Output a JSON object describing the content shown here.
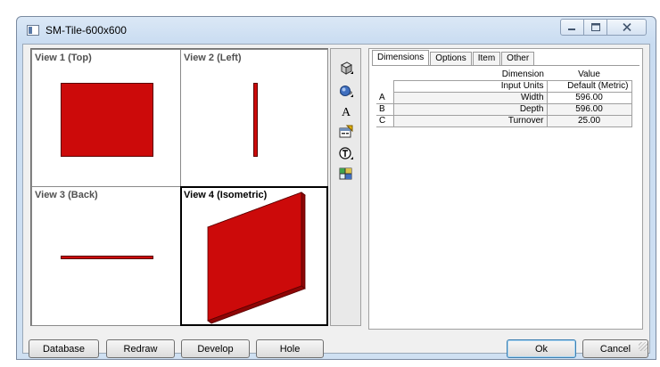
{
  "window": {
    "title": "SM-Tile-600x600"
  },
  "views": [
    {
      "label": "View 1 (Top)"
    },
    {
      "label": "View 2 (Left)"
    },
    {
      "label": "View 3 (Back)"
    },
    {
      "label": "View 4 (Isometric)"
    }
  ],
  "tools": [
    "cube-view-icon",
    "sphere-render-icon",
    "text-A-icon",
    "properties-icon",
    "dimension-T-icon",
    "grid-map-icon"
  ],
  "tabs": [
    "Dimensions",
    "Options",
    "Item",
    "Other"
  ],
  "grid": {
    "header": {
      "dimension": "Dimension",
      "value": "Value"
    },
    "subheader": {
      "dimension": "Input Units",
      "value": "Default (Metric)"
    },
    "rows": [
      {
        "key": "A",
        "name": "Width",
        "value": "596.00"
      },
      {
        "key": "B",
        "name": "Depth",
        "value": "596.00"
      },
      {
        "key": "C",
        "name": "Turnover",
        "value": "25.00"
      }
    ]
  },
  "buttons": {
    "database": "Database",
    "redraw": "Redraw",
    "develop": "Develop",
    "hole": "Hole",
    "ok": "Ok",
    "cancel": "Cancel"
  },
  "colors": {
    "tile": "#cc0a0a",
    "tile_side": "#8e0606",
    "tile_top": "#e23a3a"
  }
}
